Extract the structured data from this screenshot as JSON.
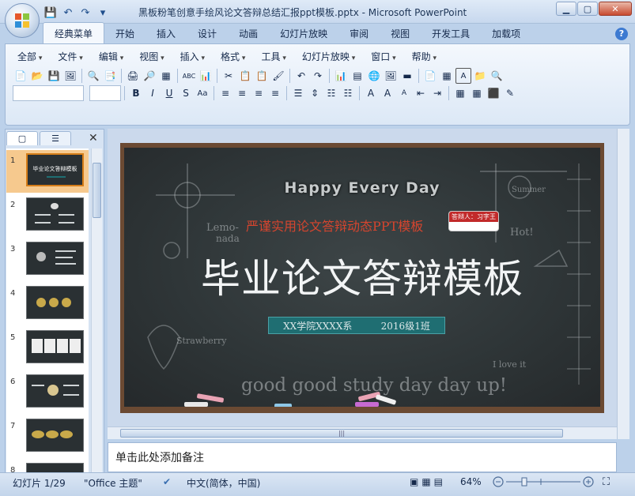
{
  "window": {
    "title": "黑板粉笔创意手绘风论文答辩总结汇报ppt模板.pptx - Microsoft PowerPoint",
    "minimize": "▁",
    "maximize": "▢",
    "close": "✕"
  },
  "quick_access": {
    "save": "💾",
    "undo": "↶",
    "redo": "↷",
    "customize": "▾"
  },
  "ribbon_tabs": [
    "经典菜单",
    "开始",
    "插入",
    "设计",
    "动画",
    "幻灯片放映",
    "审阅",
    "视图",
    "开发工具",
    "加载项"
  ],
  "help": "?",
  "menubar": [
    "全部",
    "文件",
    "编辑",
    "视图",
    "插入",
    "格式",
    "工具",
    "幻灯片放映",
    "窗口",
    "帮助"
  ],
  "toolbar_row2": [
    "📄",
    "📂",
    "💾",
    "🖼",
    "🔍",
    "📑",
    "🖨",
    "🔎",
    "▦",
    "ABC",
    "📊",
    "✂",
    "📋",
    "📋",
    "🖌",
    "↶",
    "↷",
    "📊",
    "▤",
    "🌐",
    "🖼",
    "▬",
    "📄",
    "▦",
    "A",
    "📁",
    "🔍"
  ],
  "toolbar_row3": [
    "B",
    "I",
    "U",
    "S",
    "Aa",
    "≡",
    "≡",
    "≡",
    "≡",
    "☰",
    "⇕",
    "☷",
    "☷",
    "A",
    "A",
    "A",
    "⇤",
    "⇥",
    "▦",
    "▦",
    "⬛",
    "✎"
  ],
  "slide_thumbnail_tabs": [
    "▢",
    "☰"
  ],
  "slide_thumbnail_close": "✕",
  "thumbnails": [
    {
      "num": "1"
    },
    {
      "num": "2"
    },
    {
      "num": "3"
    },
    {
      "num": "4"
    },
    {
      "num": "5"
    },
    {
      "num": "6"
    },
    {
      "num": "7"
    },
    {
      "num": "8"
    }
  ],
  "thumbnail_1_title": "毕业论文答辩模板",
  "slide": {
    "happy": "Happy Every Day",
    "subtitle": "严谨实用论文答辩动态PPT模板",
    "presenter": "答辩人：习字王",
    "title": "毕业论文答辩模板",
    "school": "XX学院XXXX系",
    "class": "2016级1班",
    "chalk_lemon": "Lemo-",
    "chalk_nada": "nada",
    "chalk_hot": "Hot!",
    "chalk_straw": "Strawberry",
    "chalk_bottom": "good good study day day up!",
    "chalk_love": "I love it",
    "chalk_summer": "Summer"
  },
  "notes_placeholder": "单击此处添加备注",
  "status": {
    "slide_count": "幻灯片 1/29",
    "theme": "\"Office 主题\"",
    "language": "中文(简体，中国)",
    "zoom": "64%"
  },
  "colors": {
    "ribbon_bg": "#dce8f6",
    "board": "#2f3638",
    "frame": "#6b4a33",
    "accent_red": "#d6452e",
    "class_bar": "#1f6e72"
  }
}
